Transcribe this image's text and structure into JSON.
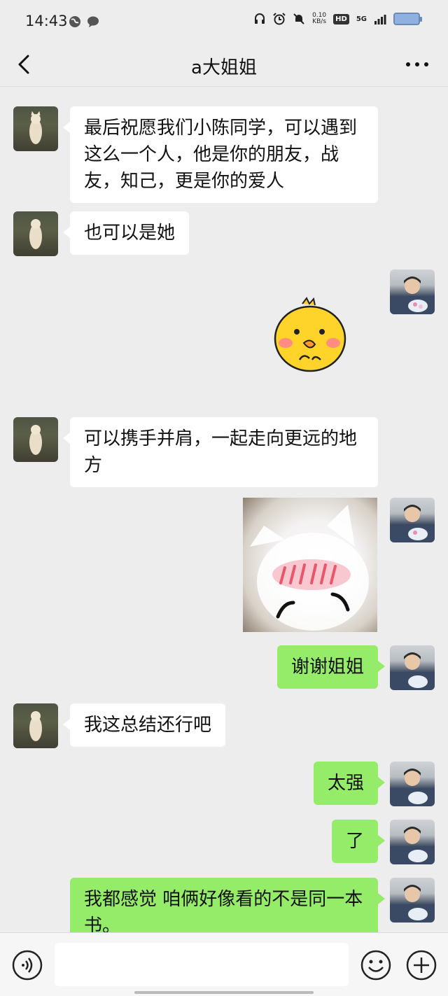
{
  "status_bar": {
    "time": "14:43",
    "net_speed_value": "0.10",
    "net_speed_unit": "KB/s",
    "hd": "HD",
    "network": "5G"
  },
  "nav": {
    "title": "a大姐姐"
  },
  "messages": [
    {
      "from": "contact",
      "text": "最后祝愿我们小陈同学，可以遇到这么一个人，他是你的朋友，战友，知己，更是你的爱人"
    },
    {
      "from": "contact",
      "text": "也可以是她"
    },
    {
      "from": "me",
      "type": "sticker",
      "sticker": "chick-sticker"
    },
    {
      "from": "contact",
      "text": "可以携手并肩，一起走向更远的地方"
    },
    {
      "from": "me",
      "type": "sticker",
      "sticker": "blushing-cat-sticker"
    },
    {
      "from": "me",
      "text": "谢谢姐姐"
    },
    {
      "from": "contact",
      "text": "我这总结还行吧"
    },
    {
      "from": "me",
      "text": "太强"
    },
    {
      "from": "me",
      "text": "了"
    },
    {
      "from": "me",
      "text": "我都感觉 咱俩好像看的不是同一本书。"
    }
  ],
  "colors": {
    "background": "#ededed",
    "incoming_bubble": "#ffffff",
    "outgoing_bubble": "#95ec69"
  }
}
